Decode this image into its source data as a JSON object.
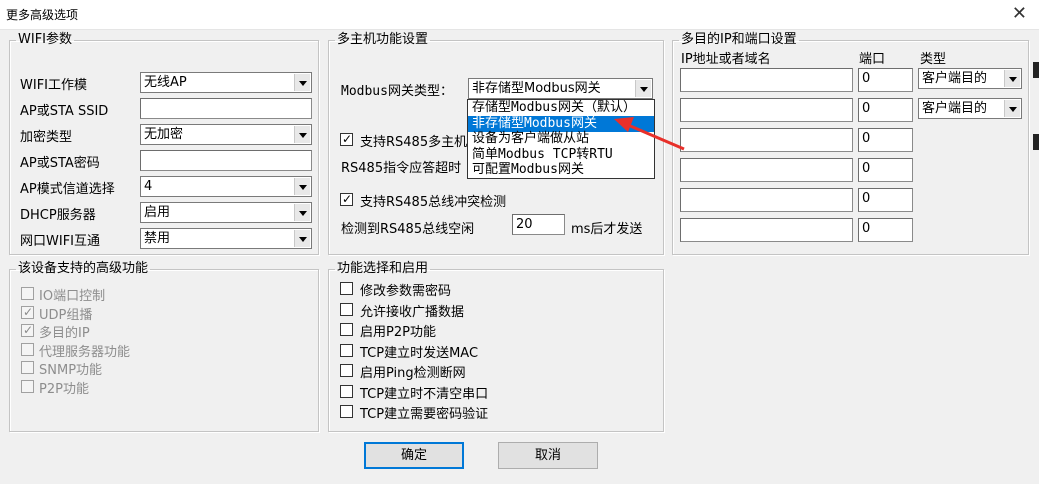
{
  "window": {
    "title": "更多高级选项",
    "close_glyph": "✕"
  },
  "wifi": {
    "legend": "WIFI参数",
    "rows": [
      {
        "label": "WIFI工作模",
        "type": "combo",
        "value": "无线AP"
      },
      {
        "label": "AP或STA SSID",
        "type": "input",
        "value": ""
      },
      {
        "label": "加密类型",
        "type": "combo",
        "value": "无加密"
      },
      {
        "label": "AP或STA密码",
        "type": "input",
        "value": ""
      },
      {
        "label": "AP模式信道选择",
        "type": "combo",
        "value": "4"
      },
      {
        "label": "DHCP服务器",
        "type": "combo",
        "value": "启用"
      },
      {
        "label": "网口WIFI互通",
        "type": "combo",
        "value": "禁用"
      }
    ]
  },
  "multihost": {
    "legend": "多主机功能设置",
    "gateway_label": "Modbus网关类型：",
    "gateway_value": "非存储型Modbus网关",
    "rs485_multihost_label": "支持RS485多主机",
    "rs485_multihost_checked": true,
    "rs485_timeout_label": "RS485指令应答超时",
    "collision_label": "支持RS485总线冲突检测",
    "collision_checked": true,
    "idle_label": "检测到RS485总线空闲",
    "idle_value": "20",
    "idle_suffix": "ms后才发送",
    "dropdown_options": [
      {
        "label": "存储型Modbus网关（默认）",
        "selected": false
      },
      {
        "label": "非存储型Modbus网关",
        "selected": true
      },
      {
        "label": "设备为客户端做从站",
        "selected": false
      },
      {
        "label": "简单Modbus TCP转RTU",
        "selected": false
      },
      {
        "label": "可配置Modbus网关",
        "selected": false
      }
    ]
  },
  "multitarget": {
    "legend": "多目的IP和端口设置",
    "col_ip": "IP地址或者域名",
    "col_port": "端口",
    "col_type": "类型",
    "rows": [
      {
        "ip": "",
        "port": "0",
        "type": "客户端目的"
      },
      {
        "ip": "",
        "port": "0",
        "type": "客户端目的"
      },
      {
        "ip": "",
        "port": "0",
        "type": ""
      },
      {
        "ip": "",
        "port": "0",
        "type": ""
      },
      {
        "ip": "",
        "port": "0",
        "type": ""
      },
      {
        "ip": "",
        "port": "0",
        "type": ""
      }
    ]
  },
  "supported": {
    "legend": "该设备支持的高级功能",
    "items": [
      {
        "label": "IO端口控制",
        "checked": false
      },
      {
        "label": "UDP组播",
        "checked": true
      },
      {
        "label": "多目的IP",
        "checked": true
      },
      {
        "label": "代理服务器功能",
        "checked": false
      },
      {
        "label": "SNMP功能",
        "checked": false
      },
      {
        "label": "P2P功能",
        "checked": false
      }
    ]
  },
  "functions": {
    "legend": "功能选择和启用",
    "items": [
      {
        "label": "修改参数需密码",
        "checked": false
      },
      {
        "label": "允许接收广播数据",
        "checked": false
      },
      {
        "label": "启用P2P功能",
        "checked": false
      },
      {
        "label": "TCP建立时发送MAC",
        "checked": false
      },
      {
        "label": "启用Ping检测断网",
        "checked": false
      },
      {
        "label": "TCP建立时不清空串口",
        "checked": false
      },
      {
        "label": "TCP建立需要密码验证",
        "checked": false
      }
    ]
  },
  "buttons": {
    "ok": "确定",
    "cancel": "取消"
  },
  "colors": {
    "highlight": "#0078d7",
    "annotation_arrow": "#e8302a"
  }
}
